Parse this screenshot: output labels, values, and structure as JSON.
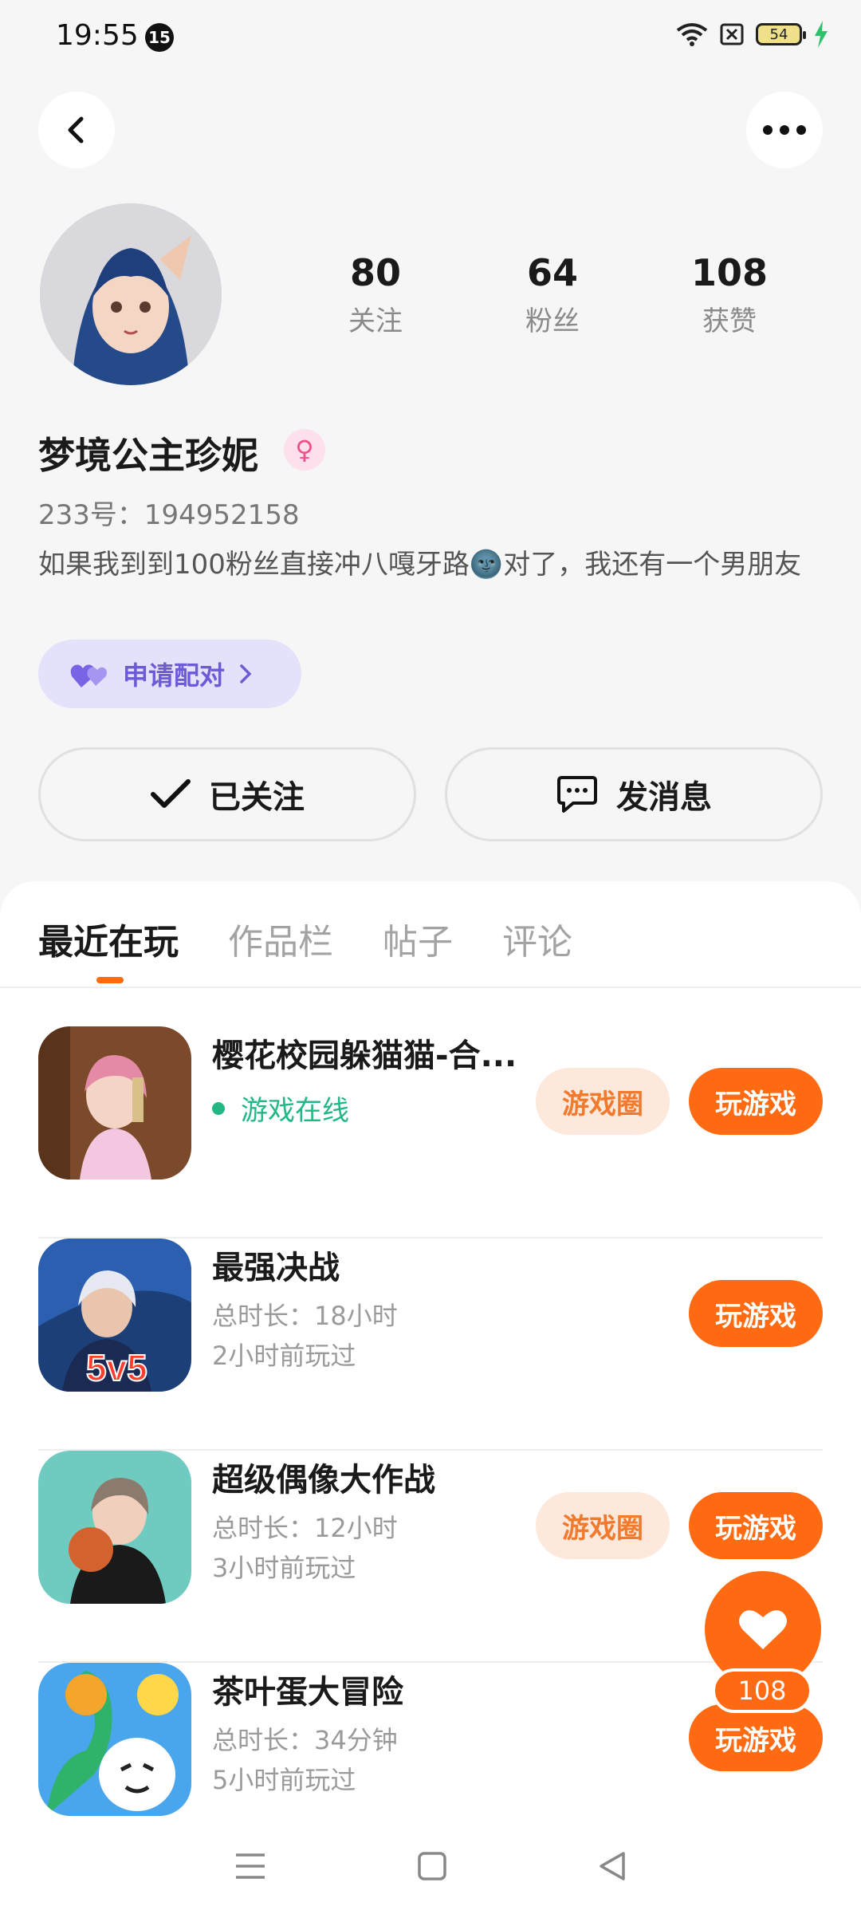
{
  "status_bar": {
    "time": "19:55",
    "notification_count": "15",
    "battery": "54"
  },
  "profile": {
    "nickname": "梦境公主珍妮",
    "gender_symbol": "♀",
    "uid": "233号：194952158",
    "bio": "如果我到到100粉丝直接冲八嘎牙路🌚对了，我还有一个男朋友",
    "stats": [
      {
        "value": "80",
        "label": "关注"
      },
      {
        "value": "64",
        "label": "粉丝"
      },
      {
        "value": "108",
        "label": "获赞"
      }
    ],
    "pair_label": "申请配对",
    "follow_label": "已关注",
    "message_label": "发消息"
  },
  "tabs": [
    {
      "label": "最近在玩",
      "active": true
    },
    {
      "label": "作品栏",
      "active": false
    },
    {
      "label": "帖子",
      "active": false
    },
    {
      "label": "评论",
      "active": false
    }
  ],
  "games": [
    {
      "title": "樱花校园躲猫猫-合...",
      "online_text": "游戏在线",
      "has_circle": true,
      "circle_label": "游戏圈",
      "play_label": "玩游戏"
    },
    {
      "title": "最强决战",
      "duration": "总时长：18小时",
      "last_played": "2小时前玩过",
      "has_circle": false,
      "play_label": "玩游戏",
      "icon_text": "5v5"
    },
    {
      "title": "超级偶像大作战",
      "duration": "总时长：12小时",
      "last_played": "3小时前玩过",
      "has_circle": true,
      "circle_label": "游戏圈",
      "play_label": "玩游戏"
    },
    {
      "title": "茶叶蛋大冒险",
      "duration": "总时长：34分钟",
      "last_played": "5小时前玩过",
      "has_circle": false,
      "play_label": "玩游戏"
    }
  ],
  "like_fab": {
    "count": "108"
  },
  "colors": {
    "accent": "#ff6a13",
    "online": "#23b784",
    "pair": "#6b5bd6"
  }
}
